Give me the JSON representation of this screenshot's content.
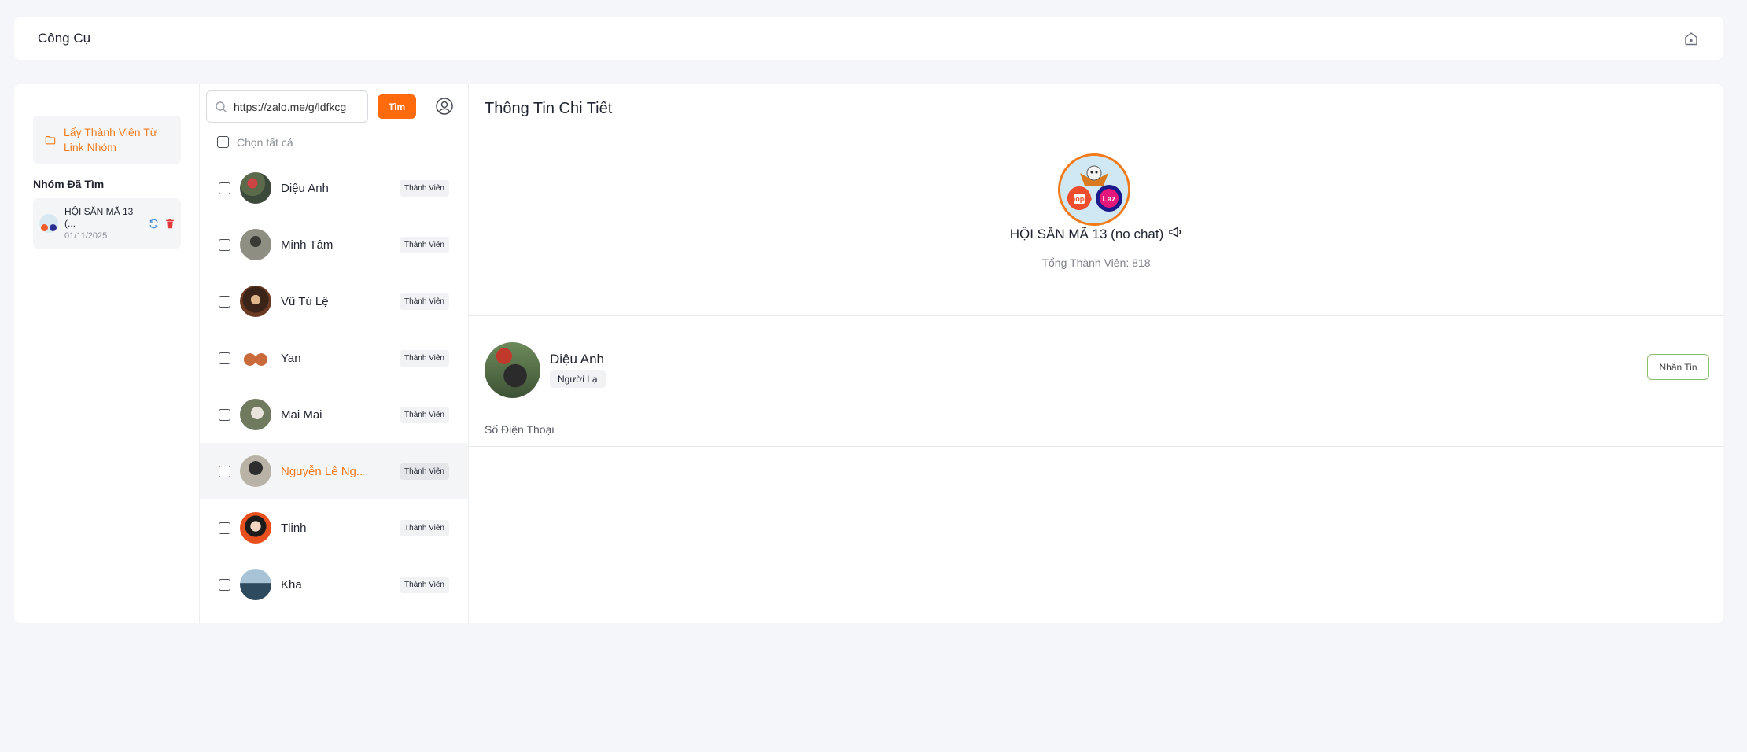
{
  "header": {
    "title": "Công Cụ",
    "home_icon": "home-icon"
  },
  "sidebar": {
    "get_members_label": "Lấy Thành Viên Từ Link Nhóm",
    "section_title": "Nhóm Đã Tìm",
    "groups": [
      {
        "name": "HỘI SĂN MÃ 13 (...",
        "date": "01/11/2025"
      }
    ]
  },
  "search": {
    "value": "https://zalo.me/g/ldfkcg",
    "button_label": "Tìm",
    "select_all_label": "Chọn tất cả"
  },
  "members": [
    {
      "name": "Diệu Anh",
      "role": "Thành Viên"
    },
    {
      "name": "Minh Tâm",
      "role": "Thành Viên"
    },
    {
      "name": "Vũ Tú Lệ",
      "role": "Thành Viên"
    },
    {
      "name": "Yan",
      "role": "Thành Viên"
    },
    {
      "name": "Mai Mai",
      "role": "Thành Viên"
    },
    {
      "name": "Nguyễn Lê Ng...",
      "role": "Thành Viên",
      "active": true
    },
    {
      "name": "Tlinh",
      "role": "Thành Viên"
    },
    {
      "name": "Kha",
      "role": "Thành Viên"
    }
  ],
  "detail": {
    "title": "Thông Tin Chi Tiết",
    "group_name": "HỘI SĂN MÃ 13 (no chat)",
    "member_count_label": "Tổng Thành Viên: 818",
    "group_logos": [
      "Shopee",
      "Laz"
    ],
    "selected_user": {
      "name": "Diệu Anh",
      "tag": "Người Lạ",
      "message_button": "Nhắn Tin",
      "phone_label": "Số Điện Thoại"
    }
  },
  "colors": {
    "accent": "#ff6a0d",
    "accent_text": "#f27a1a",
    "background": "#f4f6fa"
  }
}
